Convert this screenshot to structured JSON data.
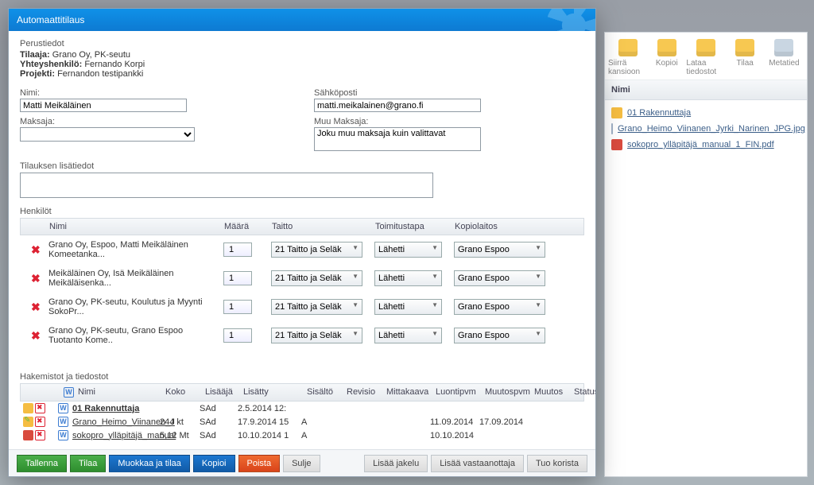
{
  "modal_title": "Automaattitilaus",
  "sections": {
    "perustiedot": "Perustiedot",
    "henkilot": "Henkilöt",
    "hakemistot": "Hakemistot ja tiedostot",
    "lisatiedot": "Tilauksen lisätiedot"
  },
  "info": {
    "tilaaja_label": "Tilaaja:",
    "tilaaja_value": "Grano Oy, PK-seutu",
    "yhteys_label": "Yhteyshenkilö:",
    "yhteys_value": "Fernando Korpi",
    "projekti_label": "Projekti:",
    "projekti_value": "Fernandon testipankki"
  },
  "fields": {
    "nimi_label": "Nimi:",
    "nimi_value": "Matti Meikäläinen",
    "sposti_label": "Sähköposti",
    "sposti_value": "matti.meikalainen@grano.fi",
    "maksaja_label": "Maksaja:",
    "muu_label": "Muu Maksaja:",
    "muu_value": "Joku muu maksaja kuin valittavat"
  },
  "people_headers": {
    "nimi": "Nimi",
    "maara": "Määrä",
    "taitto": "Taitto",
    "toimitus": "Toimitustapa",
    "kopio": "Kopiolaitos"
  },
  "people": [
    {
      "name": "Grano Oy, Espoo, Matti Meikäläinen Komeetanka...",
      "qty": "1",
      "taitto": "21 Taitto ja Seläk",
      "toim": "Lähetti",
      "kopio": "Grano Espoo"
    },
    {
      "name": "Meikäläinen Oy, Isä Meikäläinen Meikäläisenka...",
      "qty": "1",
      "taitto": "21 Taitto ja Seläk",
      "toim": "Lähetti",
      "kopio": "Grano Espoo"
    },
    {
      "name": "Grano Oy, PK-seutu, Koulutus ja Myynti SokoPr...",
      "qty": "1",
      "taitto": "21 Taitto ja Seläk",
      "toim": "Lähetti",
      "kopio": "Grano Espoo"
    },
    {
      "name": "Grano Oy, PK-seutu, Grano Espoo Tuotanto Kome..",
      "qty": "1",
      "taitto": "21 Taitto ja Seläk",
      "toim": "Lähetti",
      "kopio": "Grano Espoo"
    }
  ],
  "file_headers": {
    "nimi": "Nimi",
    "koko": "Koko",
    "lisaaja": "Lisääjä",
    "lisatty": "Lisätty",
    "sisalto": "Sisältö",
    "revisio": "Revisio",
    "mitta": "Mittakaava",
    "luonti": "Luontipvm",
    "muutospvm": "Muutospvm",
    "muutos": "Muutos",
    "status": "Status"
  },
  "files": [
    {
      "name": "01 Rakennuttaja",
      "size": "",
      "adder": "SAd",
      "added": "2.5.2014 12:",
      "content": "",
      "rev": "",
      "scale": "",
      "created": "",
      "modpvm": "",
      "mod": "",
      "status": ""
    },
    {
      "name": "Grano_Heimo_Viinanen_J",
      "size": "244 kt",
      "adder": "SAd",
      "added": "17.9.2014 15",
      "content": "A",
      "rev": "",
      "scale": "",
      "created": "11.09.2014",
      "modpvm": "17.09.2014",
      "mod": "",
      "status": ""
    },
    {
      "name": "sokopro_ylläpitäjä_manual",
      "size": "5,12 Mt",
      "adder": "SAd",
      "added": "10.10.2014 1",
      "content": "A",
      "rev": "",
      "scale": "",
      "created": "10.10.2014",
      "modpvm": "",
      "mod": "",
      "status": ""
    }
  ],
  "footer": {
    "tallenna": "Tallenna",
    "tilaa": "Tilaa",
    "muokkaa": "Muokkaa ja tilaa",
    "kopioi": "Kopioi",
    "poista": "Poista",
    "sulje": "Sulje",
    "lisaa_jakelu": "Lisää jakelu",
    "lisaa_vast": "Lisää vastaanottaja",
    "tuo": "Tuo korista"
  },
  "bg": {
    "tb": {
      "siirra": "Siirrä kansioon",
      "kopioi": "Kopioi",
      "lataa": "Lataa tiedostot",
      "tilaa": "Tilaa",
      "meta": "Metatied"
    },
    "head": "Nimi",
    "rows": [
      {
        "name": "01 Rakennuttaja"
      },
      {
        "name": "Grano_Heimo_Viinanen_Jyrki_Narinen_JPG.jpg"
      },
      {
        "name": "sokopro_ylläpitäjä_manual_1_FIN.pdf"
      }
    ]
  }
}
